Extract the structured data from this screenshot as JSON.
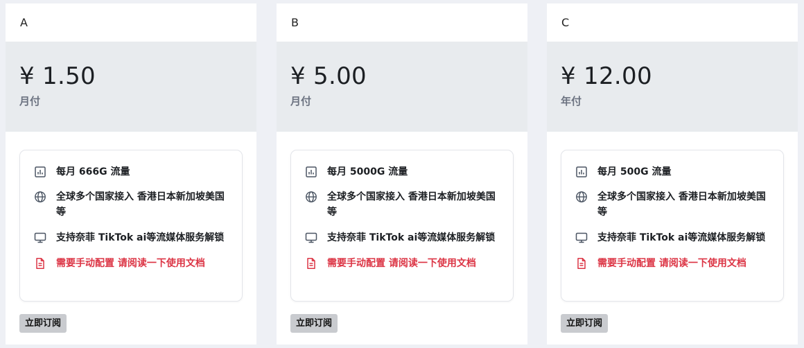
{
  "plans": [
    {
      "name": "A",
      "price": "¥ 1.50",
      "period": "月付",
      "features": [
        {
          "icon": "bar-chart-icon",
          "text": "每月 666G 流量"
        },
        {
          "icon": "globe-icon",
          "text": "全球多个国家接入 香港日本新加坡美国等"
        },
        {
          "icon": "monitor-icon",
          "text": "支持奈菲 TikTok ai等流媒体服务解锁"
        },
        {
          "icon": "document-icon",
          "text": "需要手动配置 请阅读一下使用文档"
        }
      ],
      "button": "立即订阅"
    },
    {
      "name": "B",
      "price": "¥ 5.00",
      "period": "月付",
      "features": [
        {
          "icon": "bar-chart-icon",
          "text": "每月 5000G 流量"
        },
        {
          "icon": "globe-icon",
          "text": "全球多个国家接入 香港日本新加坡美国等"
        },
        {
          "icon": "monitor-icon",
          "text": "支持奈菲 TikTok ai等流媒体服务解锁"
        },
        {
          "icon": "document-icon",
          "text": "需要手动配置 请阅读一下使用文档"
        }
      ],
      "button": "立即订阅"
    },
    {
      "name": "C",
      "price": "¥ 12.00",
      "period": "年付",
      "features": [
        {
          "icon": "bar-chart-icon",
          "text": "每月 500G 流量"
        },
        {
          "icon": "globe-icon",
          "text": "全球多个国家接入 香港日本新加坡美国等"
        },
        {
          "icon": "monitor-icon",
          "text": "支持奈菲 TikTok ai等流媒体服务解锁"
        },
        {
          "icon": "document-icon",
          "text": "需要手动配置 请阅读一下使用文档"
        }
      ],
      "button": "立即订阅"
    }
  ],
  "colors": {
    "background": "#eef0f5",
    "price_band": "#e8ebee",
    "warning_text": "#dc3545",
    "button_bg": "#c9cbcf"
  }
}
